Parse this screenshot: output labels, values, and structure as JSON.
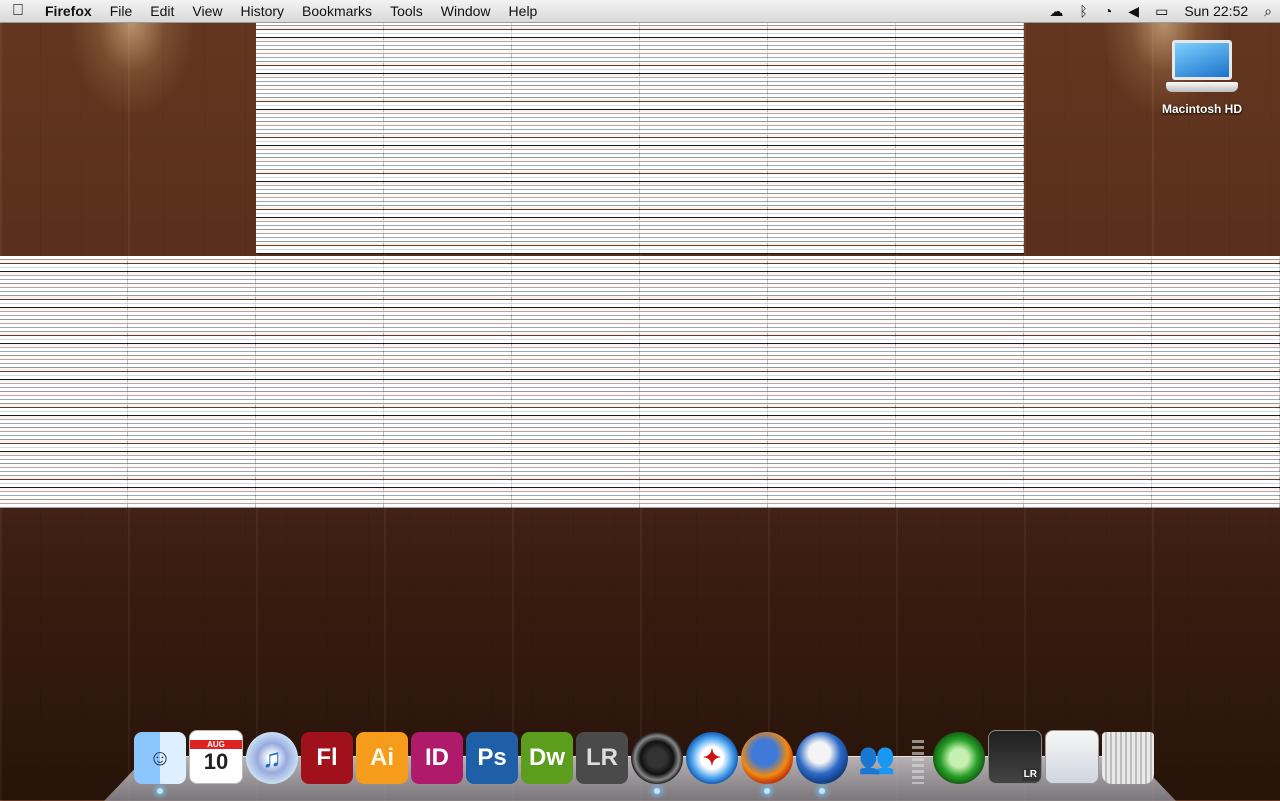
{
  "menubar": {
    "apple_icon": "apple-logo-icon",
    "app_name": "Firefox",
    "menus": [
      "File",
      "Edit",
      "View",
      "History",
      "Bookmarks",
      "Tools",
      "Window",
      "Help"
    ],
    "clock": "Sun 22:52",
    "status_icons": [
      "sync-icon",
      "bluetooth-icon",
      "wifi-icon",
      "volume-icon",
      "battery-icon",
      "spotlight-icon"
    ]
  },
  "desktop": {
    "icons": [
      {
        "label": "Macintosh HD",
        "icon": "laptop-drive-icon"
      }
    ]
  },
  "dock": {
    "items": [
      {
        "id": "finder",
        "icon": "finder-icon",
        "glyph": "☺",
        "running": true
      },
      {
        "id": "ical",
        "icon": "ical-icon",
        "month": "AUG",
        "day": "10",
        "running": false
      },
      {
        "id": "itunes",
        "icon": "itunes-icon",
        "glyph": "♫",
        "running": false
      },
      {
        "id": "flash",
        "icon": "flash-icon",
        "text": "Fl",
        "running": false
      },
      {
        "id": "illustrator",
        "icon": "illustrator-icon",
        "text": "Ai",
        "running": false
      },
      {
        "id": "indesign",
        "icon": "indesign-icon",
        "text": "ID",
        "running": false
      },
      {
        "id": "photoshop",
        "icon": "photoshop-icon",
        "text": "Ps",
        "running": false
      },
      {
        "id": "dreamweaver",
        "icon": "dreamweaver-icon",
        "text": "Dw",
        "running": false
      },
      {
        "id": "lightroom",
        "icon": "lightroom-icon",
        "text": "LR",
        "running": false
      },
      {
        "id": "camera",
        "icon": "camera-icon",
        "running": true
      },
      {
        "id": "safari",
        "icon": "safari-icon",
        "glyph": "✦",
        "running": false
      },
      {
        "id": "firefox",
        "icon": "firefox-icon",
        "running": true
      },
      {
        "id": "thunderbird",
        "icon": "thunderbird-icon",
        "running": true
      },
      {
        "id": "messenger",
        "icon": "messenger-icon",
        "glyph": "👥",
        "running": false
      }
    ],
    "right_items": [
      {
        "id": "timemachine",
        "icon": "time-machine-icon",
        "running": false
      },
      {
        "id": "lightroom-window",
        "icon": "lightroom-window-thumbnail-icon",
        "badge": "LR"
      },
      {
        "id": "firefox-window",
        "icon": "firefox-window-thumbnail-icon"
      },
      {
        "id": "trash",
        "icon": "trash-icon"
      }
    ]
  }
}
